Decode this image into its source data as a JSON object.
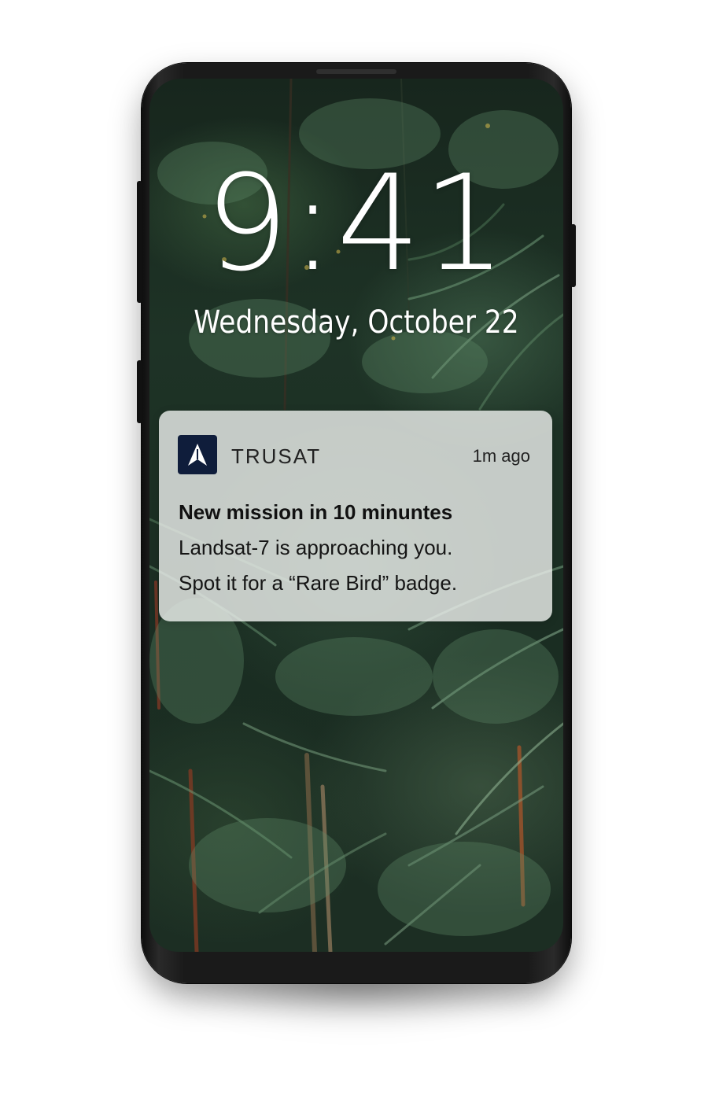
{
  "lockscreen": {
    "time": "9:41",
    "date": "Wednesday, October 22"
  },
  "notification": {
    "app_icon": "trusat-logo-icon",
    "app_name": "TRUSAT",
    "timestamp": "1m ago",
    "title": "New mission in 10 minuntes",
    "body_lines": [
      "Landsat-7 is approaching you.",
      "Spot it for a “Rare Bird” badge."
    ]
  },
  "colors": {
    "app_icon_bg": "#0f1d3b",
    "notification_bg": "#f0f3f0",
    "phone_body": "#1a1a1a"
  }
}
